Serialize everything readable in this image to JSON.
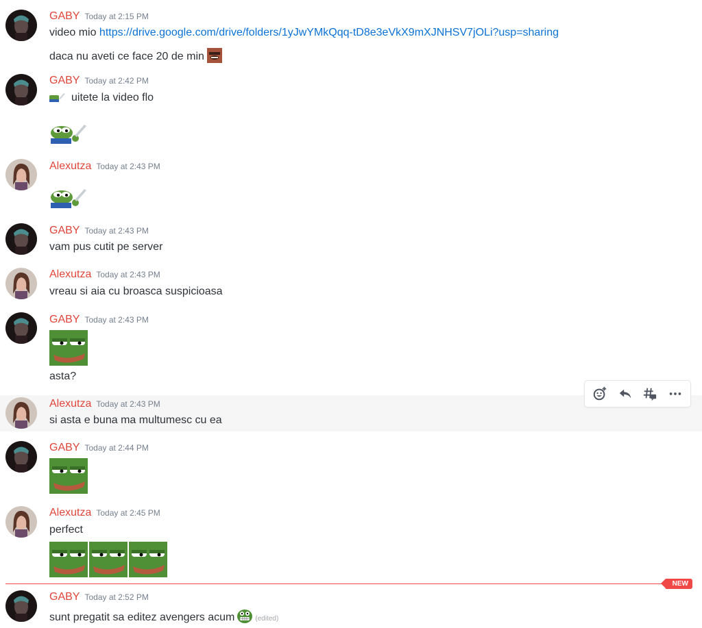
{
  "messages": [
    {
      "author": "GABY",
      "time": "Today at 2:15 PM",
      "line1_text": "video mio ",
      "link": "https://drive.google.com/drive/folders/1yJwYMkQqq-tD8e3eVkX9mXJNHSV7jOLi?usp=sharing",
      "line2_text": "daca nu aveti ce face 20 de min"
    },
    {
      "author": "GABY",
      "time": "Today at 2:42 PM",
      "text": "uitete la video flo"
    },
    {
      "author": "Alexutza",
      "time": "Today at 2:43 PM"
    },
    {
      "author": "GABY",
      "time": "Today at 2:43 PM",
      "text": "vam pus cutit pe server"
    },
    {
      "author": "Alexutza",
      "time": "Today at 2:43 PM",
      "text": "vreau si aia cu broasca suspicioasa"
    },
    {
      "author": "GABY",
      "time": "Today at 2:43 PM",
      "text": "asta?"
    },
    {
      "author": "Alexutza",
      "time": "Today at 2:43 PM",
      "text": "si asta e buna ma multumesc cu ea"
    },
    {
      "author": "GABY",
      "time": "Today at 2:44 PM"
    },
    {
      "author": "Alexutza",
      "time": "Today at 2:45 PM",
      "text": "perfect"
    },
    {
      "author": "GABY",
      "time": "Today at 2:52 PM",
      "text": "sunt pregatit sa editez avengers acum",
      "edited": "(edited)"
    }
  ],
  "toolbar": {
    "icons": [
      "add-reaction-icon",
      "reply-icon",
      "create-thread-icon",
      "more-icon"
    ]
  },
  "divider": {
    "label": "NEW"
  },
  "colors": {
    "author": "#e0453a",
    "link": "#0b72d6",
    "new": "#f04747",
    "hover": "#f6f6f7"
  }
}
